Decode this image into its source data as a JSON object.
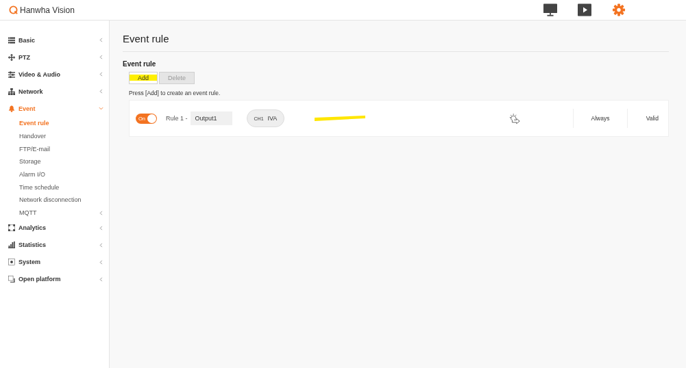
{
  "header": {
    "logo": "Hanwha Vision",
    "tabs": [
      {
        "selected": false
      },
      {
        "selected": false
      },
      {
        "selected": true
      }
    ]
  },
  "sidebar": {
    "items": [
      {
        "label": "Basic",
        "expanded": false,
        "selected": false
      },
      {
        "label": "PTZ",
        "expanded": false,
        "selected": false
      },
      {
        "label": "Video & Audio",
        "expanded": false,
        "selected": false
      },
      {
        "label": "Network",
        "expanded": false,
        "selected": false
      },
      {
        "label": "Event",
        "expanded": true,
        "selected": true,
        "children": [
          {
            "label": "Event rule",
            "selected": true,
            "has_submenu": false
          },
          {
            "label": "Handover",
            "selected": false,
            "has_submenu": false
          },
          {
            "label": "FTP/E-mail",
            "selected": false,
            "has_submenu": false
          },
          {
            "label": "Storage",
            "selected": false,
            "has_submenu": false
          },
          {
            "label": "Alarm I/O",
            "selected": false,
            "has_submenu": false
          },
          {
            "label": "Time schedule",
            "selected": false,
            "has_submenu": false
          },
          {
            "label": "Network disconnection",
            "selected": false,
            "has_submenu": false
          },
          {
            "label": "MQTT",
            "selected": false,
            "has_submenu": true
          }
        ]
      },
      {
        "label": "Analytics",
        "expanded": false,
        "selected": false
      },
      {
        "label": "Statistics",
        "expanded": false,
        "selected": false
      },
      {
        "label": "System",
        "expanded": false,
        "selected": false
      },
      {
        "label": "Open platform",
        "expanded": false,
        "selected": false
      }
    ]
  },
  "page_title": "Event rule",
  "section_title": "Event rule",
  "buttons": [
    {
      "label": "Add",
      "disabled": false,
      "highlighted": true
    },
    {
      "label": "Delete",
      "disabled": true,
      "highlighted": false
    }
  ],
  "hint": "Press [Add] to create an event rule.",
  "rules": [
    {
      "on": true,
      "toggle_label": "On",
      "name": "Rule 1 -",
      "output": "Output1",
      "channel": "CH1",
      "event": "IVA",
      "annotated": true,
      "schedule": "Always",
      "status": "Valid"
    }
  ]
}
